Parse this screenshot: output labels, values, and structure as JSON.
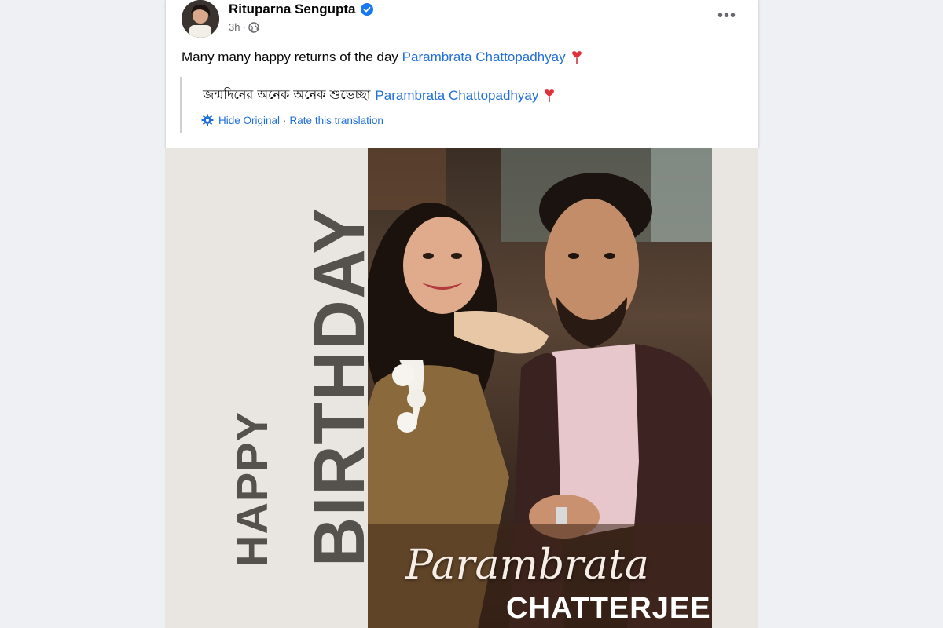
{
  "post": {
    "author": "Rituparna Sengupta",
    "time": "3h",
    "separator": "·",
    "more_label": "•••",
    "message_text": "Many many happy returns of the day",
    "message_link": "Parambrata Chattopadhyay",
    "translation": {
      "original_text": "জন্মদিনের অনেক অনেক শুভেচ্ছা",
      "original_link": "Parambrata Chattopadhyay",
      "hide_original": "Hide Original",
      "separator": "·",
      "rate_translation": "Rate this translation"
    },
    "colors": {
      "link": "#216fdb",
      "verified_badge": "#1877f2",
      "heart": "#e0303a"
    },
    "icons": [
      "avatar",
      "verified-badge-icon",
      "globe-icon",
      "more-options-icon",
      "heart-icon",
      "gear-icon"
    ]
  },
  "image": {
    "vertical_line_1": "HAPPY",
    "vertical_line_2": "BIRTHDAY",
    "script_name": "Parambrata",
    "block_name": "CHATTERJEE",
    "colors": {
      "panel": "#e9e6e2",
      "vertical_text": "#55514c"
    }
  }
}
